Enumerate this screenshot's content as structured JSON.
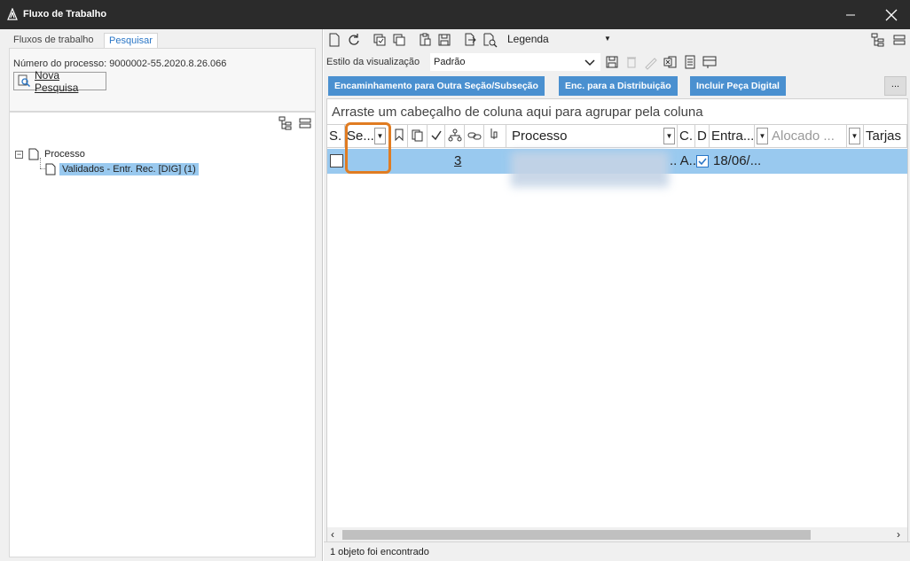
{
  "window": {
    "title": "Fluxo de Trabalho",
    "minimize": "—",
    "close": "✕"
  },
  "left": {
    "tabs": [
      "Fluxos de trabalho",
      "Pesquisar"
    ],
    "process_number_label": "Número do processo: 9000002-55.2020.8.26.066",
    "new_search_button": "Nova Pesquisa",
    "tree": {
      "root_label": "Processo",
      "child_label": "Validados - Entr. Rec. [DIG] (1)",
      "expander": "⊟"
    }
  },
  "right": {
    "legend_label": "Legenda",
    "view_style_label": "Estilo da visualização",
    "view_style_value": "Padrão",
    "actions": [
      "Encaminhamento para Outra Seção/Subseção",
      "Enc. para a Distribuição",
      "Incluir Peça Digital"
    ],
    "more_label": "...",
    "group_hint": "Arraste um cabeçalho de coluna aqui para agrupar pela coluna",
    "columns": {
      "s": "S.",
      "se": "Se...",
      "processo": "Processo",
      "c": "C.",
      "d": "D",
      "entra": "Entra...",
      "alocado": "Alocado ...",
      "tarjas": "Tarjas"
    },
    "row": {
      "count": "3",
      "col_a": ".. A..",
      "date": "18/06/..."
    },
    "status": "1 objeto foi encontrado"
  },
  "colors": {
    "accent": "#4a90d0",
    "selection": "#99c9ef",
    "highlight": "#e07c22",
    "titlebar": "#2b2b2b"
  }
}
